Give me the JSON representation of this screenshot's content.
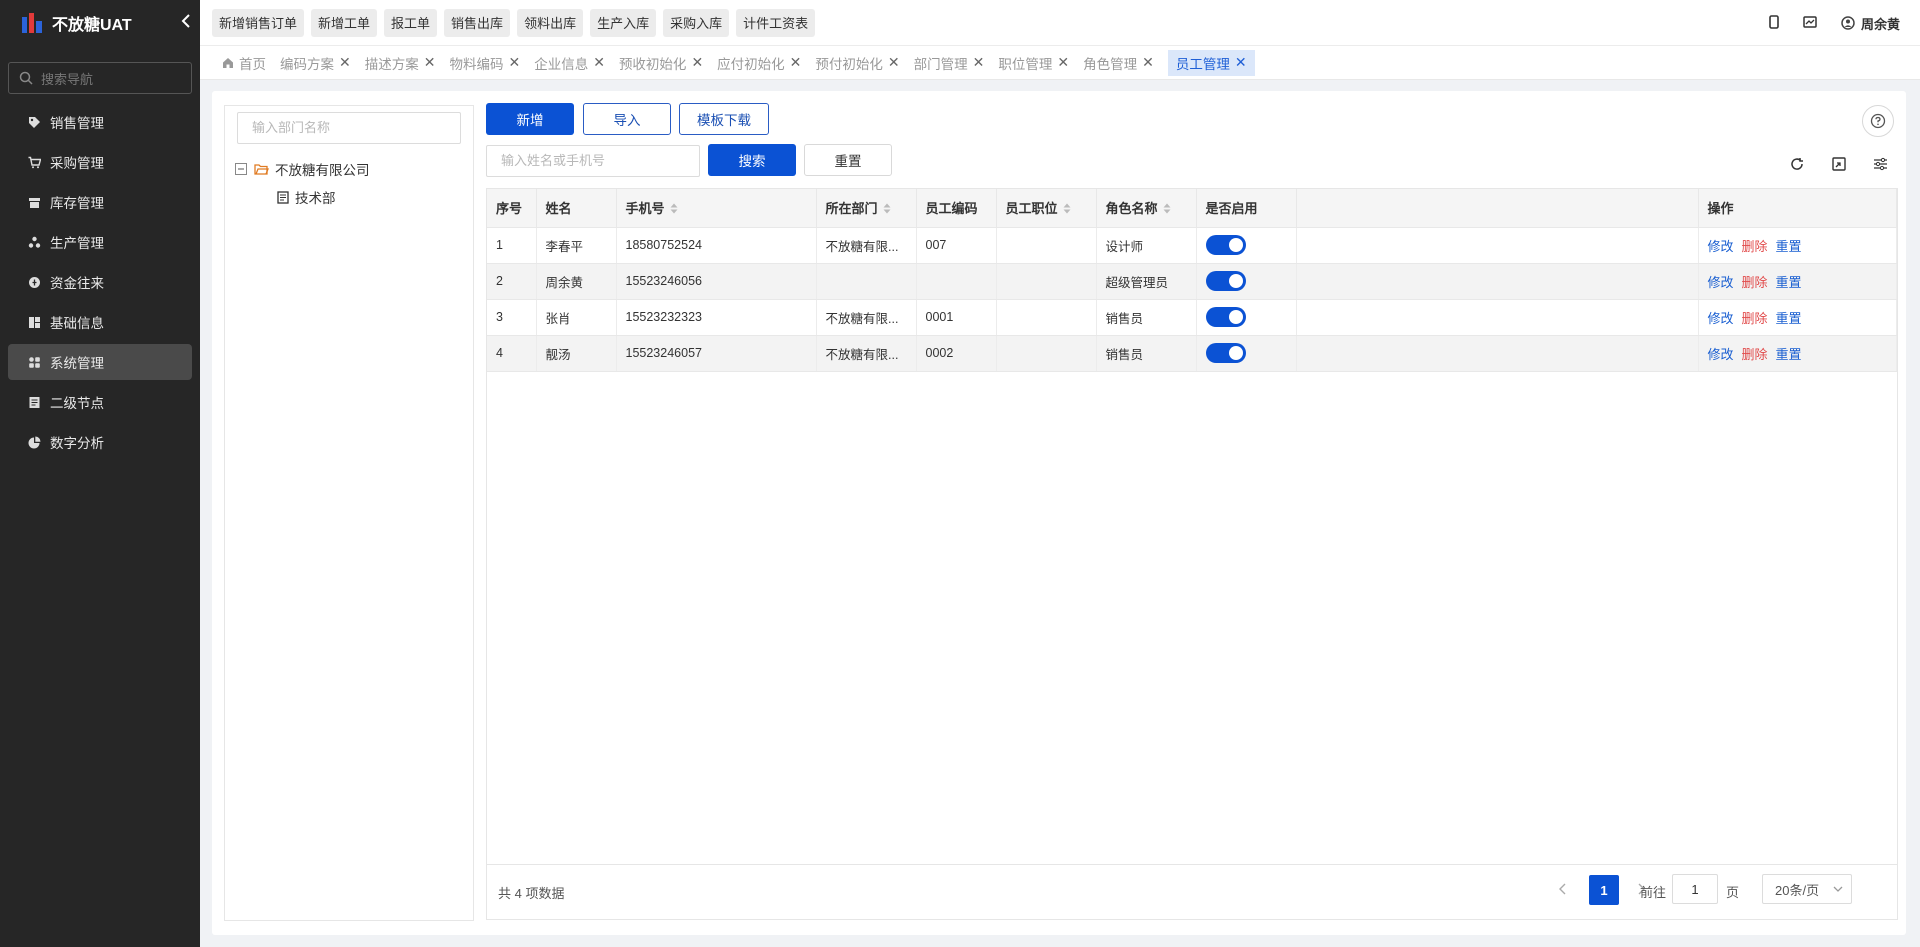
{
  "app": {
    "name": "不放糖UAT",
    "collapse_icon": "chevron-left-icon"
  },
  "sidebar": {
    "search_placeholder": "搜索导航",
    "items": [
      {
        "label": "销售管理",
        "icon": "tag-icon",
        "active": false
      },
      {
        "label": "采购管理",
        "icon": "cart-icon",
        "active": false
      },
      {
        "label": "库存管理",
        "icon": "box-icon",
        "active": false
      },
      {
        "label": "生产管理",
        "icon": "factory-icon",
        "active": false
      },
      {
        "label": "资金往来",
        "icon": "coin-icon",
        "active": false
      },
      {
        "label": "基础信息",
        "icon": "grid-info-icon",
        "active": false
      },
      {
        "label": "系统管理",
        "icon": "apps-icon",
        "active": true
      },
      {
        "label": "二级节点",
        "icon": "doc-icon",
        "active": false
      },
      {
        "label": "数字分析",
        "icon": "pie-chart-icon",
        "active": false
      }
    ]
  },
  "topbar": {
    "quick_links": [
      "新增销售订单",
      "新增工单",
      "报工单",
      "销售出库",
      "领料出库",
      "生产入库",
      "采购入库",
      "计件工资表"
    ],
    "user_name": "周余黄"
  },
  "tabs": [
    {
      "label": "首页",
      "closable": false,
      "active": false
    },
    {
      "label": "编码方案",
      "closable": true,
      "active": false
    },
    {
      "label": "描述方案",
      "closable": true,
      "active": false
    },
    {
      "label": "物料编码",
      "closable": true,
      "active": false
    },
    {
      "label": "企业信息",
      "closable": true,
      "active": false
    },
    {
      "label": "预收初始化",
      "closable": true,
      "active": false
    },
    {
      "label": "应付初始化",
      "closable": true,
      "active": false
    },
    {
      "label": "预付初始化",
      "closable": true,
      "active": false
    },
    {
      "label": "部门管理",
      "closable": true,
      "active": false
    },
    {
      "label": "职位管理",
      "closable": true,
      "active": false
    },
    {
      "label": "角色管理",
      "closable": true,
      "active": false
    },
    {
      "label": "员工管理",
      "closable": true,
      "active": true
    }
  ],
  "dept_tree": {
    "search_placeholder": "输入部门名称",
    "root": "不放糖有限公司",
    "children": [
      "技术部"
    ]
  },
  "toolbar": {
    "add_label": "新增",
    "import_label": "导入",
    "template_label": "模板下载",
    "search_placeholder": "输入姓名或手机号",
    "search_label": "搜索",
    "reset_label": "重置"
  },
  "table": {
    "columns": [
      "序号",
      "姓名",
      "手机号",
      "所在部门",
      "员工编码",
      "员工职位",
      "角色名称",
      "是否启用",
      "",
      "操作"
    ],
    "rows": [
      {
        "no": "1",
        "name": "李春平",
        "phone": "18580752524",
        "dept": "不放糖有限...",
        "code": "007",
        "position": "",
        "role": "设计师",
        "enabled": true
      },
      {
        "no": "2",
        "name": "周余黄",
        "phone": "15523246056",
        "dept": "",
        "code": "",
        "position": "",
        "role": "超级管理员",
        "enabled": true
      },
      {
        "no": "3",
        "name": "张肖",
        "phone": "15523232323",
        "dept": "不放糖有限...",
        "code": "0001",
        "position": "",
        "role": "销售员",
        "enabled": true
      },
      {
        "no": "4",
        "name": "靓汤",
        "phone": "15523246057",
        "dept": "不放糖有限...",
        "code": "0002",
        "position": "",
        "role": "销售员",
        "enabled": true
      }
    ],
    "actions": {
      "edit": "修改",
      "delete": "删除",
      "reset": "重置"
    }
  },
  "pagination": {
    "total_text": "共 4 项数据",
    "current_page": "1",
    "goto_label": "前往",
    "goto_value": "1",
    "page_unit": "页",
    "page_size": "20条/页"
  },
  "colors": {
    "primary": "#0b52d4",
    "sidebar_bg": "#262626",
    "danger": "#e14a4a"
  }
}
